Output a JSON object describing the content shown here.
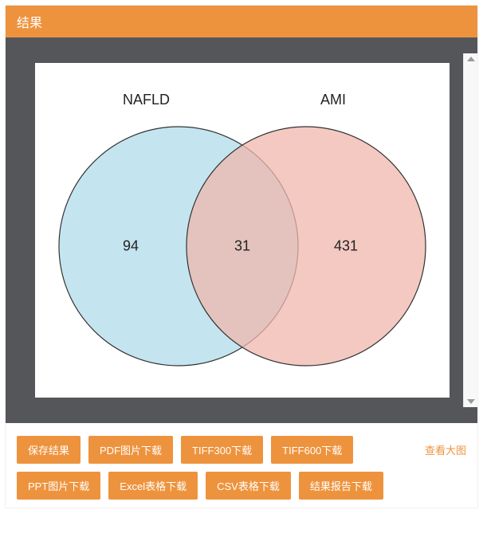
{
  "header": {
    "title": "结果"
  },
  "toolbar": {
    "save": "保存结果",
    "pdf": "PDF图片下载",
    "tiff300": "TIFF300下载",
    "tiff600": "TIFF600下载",
    "ppt": "PPT图片下载",
    "excel": "Excel表格下载",
    "csv": "CSV表格下载",
    "report": "结果报告下载",
    "view_large": "查看大图"
  },
  "chart_data": {
    "type": "venn",
    "sets": [
      {
        "name": "NAFLD",
        "only": 94,
        "color": "#b0dce9"
      },
      {
        "name": "AMI",
        "only": 431,
        "color": "#efb7ad"
      }
    ],
    "intersection": 31
  }
}
